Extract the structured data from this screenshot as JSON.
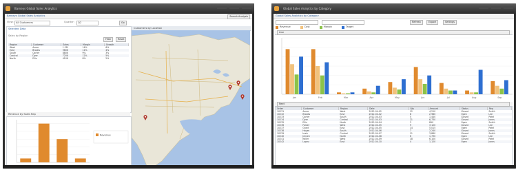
{
  "left_window": {
    "title": "Barneys Global Sales Analytics",
    "header_button": "Search Analysis",
    "toolbar": {
      "field_a_label": "View:",
      "field_a_value": "All Customers",
      "field_b_label": "Quarter:",
      "field_b_value": "Q2",
      "go_label": "Go"
    },
    "filter_title": "Selected Data",
    "list_title": "Sales by Region",
    "mini_btn_a": "Filter",
    "mini_btn_b": "Reset",
    "table": {
      "headers": [
        "Region",
        "Customer",
        "Sales",
        "Margin",
        "Growth"
      ],
      "rows": [
        [
          "West",
          "Acme",
          "1.2M",
          "14%",
          "6%"
        ],
        [
          "East",
          "Brooks",
          "960K",
          "11%",
          "4%"
        ],
        [
          "South",
          "Carter",
          "880K",
          "9%",
          "3%"
        ],
        [
          "Central",
          "Dyer",
          "720K",
          "12%",
          "5%"
        ],
        [
          "North",
          "Ellis",
          "410K",
          "8%",
          "2%"
        ]
      ]
    },
    "map_title": "Customers by Location",
    "map_pins": [
      {
        "name": "pin-west-coast",
        "color": "#c0392b"
      },
      {
        "name": "pin-chicago",
        "color": "#c0392b"
      },
      {
        "name": "pin-northeast",
        "color": "#c0392b"
      },
      {
        "name": "pin-southeast",
        "color": "#c0392b"
      }
    ],
    "bar_panel_title": "Revenue by Sales Rep",
    "bar_legend": [
      "Revenue"
    ]
  },
  "right_window": {
    "title": "Global Sales Analytics by Category",
    "toolbar_buttons": [
      "Refresh",
      "Export",
      "Settings"
    ],
    "legend": [
      "Revenue",
      "Cost",
      "Margin",
      "Target"
    ],
    "chart_title": "Sales Trends",
    "chart_buttons": [
      "Bar",
      "Line"
    ],
    "table_title": "Transactions",
    "table_buttons": [
      "Prev",
      "Next"
    ],
    "table": {
      "headers": [
        "Order",
        "Customer",
        "Region",
        "Date",
        "Qty",
        "Amount",
        "Status",
        "Rep"
      ],
      "rows": [
        [
          "10231",
          "Acme",
          "West",
          "2012-04-02",
          "12",
          "4,210",
          "Closed",
          "Smith"
        ],
        [
          "10232",
          "Brooks",
          "East",
          "2012-04-02",
          "8",
          "2,980",
          "Open",
          "Lee"
        ],
        [
          "10233",
          "Carter",
          "South",
          "2012-04-03",
          "5",
          "1,440",
          "Closed",
          "Patel"
        ],
        [
          "10234",
          "Dyer",
          "Central",
          "2012-04-03",
          "21",
          "6,730",
          "Closed",
          "Jones"
        ],
        [
          "10235",
          "Ellis",
          "North",
          "2012-04-04",
          "3",
          "890",
          "Open",
          "Smith"
        ],
        [
          "10236",
          "Foster",
          "West",
          "2012-04-05",
          "9",
          "3,120",
          "Closed",
          "Lee"
        ],
        [
          "10237",
          "Grant",
          "East",
          "2012-04-05",
          "14",
          "5,015",
          "Open",
          "Patel"
        ],
        [
          "10238",
          "Hayes",
          "South",
          "2012-04-06",
          "7",
          "2,240",
          "Closed",
          "Jones"
        ],
        [
          "10239",
          "Irwin",
          "Central",
          "2012-04-07",
          "11",
          "3,860",
          "Closed",
          "Smith"
        ],
        [
          "10240",
          "Jensen",
          "North",
          "2012-04-08",
          "6",
          "1,730",
          "Open",
          "Lee"
        ],
        [
          "10241",
          "Keller",
          "West",
          "2012-04-09",
          "18",
          "6,100",
          "Closed",
          "Patel"
        ],
        [
          "10242",
          "Lopez",
          "East",
          "2012-04-10",
          "4",
          "1,120",
          "Open",
          "Jones"
        ]
      ]
    }
  },
  "chart_data": [
    {
      "type": "bar",
      "categories": [
        "Rep 1",
        "Rep 2",
        "Rep 3",
        "Rep 4"
      ],
      "values": [
        0.1,
        1.0,
        0.6,
        0.1
      ],
      "ylim": [
        0,
        1.1
      ]
    },
    {
      "type": "bar",
      "categories": [
        "Jan",
        "Feb",
        "Mar",
        "Apr",
        "May",
        "Jun",
        "Jul",
        "Aug",
        "Sep"
      ],
      "series": [
        {
          "name": "Revenue",
          "color": "#e08a2e",
          "values": [
            4.8,
            4.8,
            0.2,
            0.6,
            1.3,
            2.9,
            1.2,
            0.4,
            1.4
          ]
        },
        {
          "name": "Cost",
          "color": "#f1c27d",
          "values": [
            3.2,
            3.0,
            0.1,
            0.3,
            0.7,
            1.6,
            0.6,
            0.2,
            0.9
          ]
        },
        {
          "name": "Margin",
          "color": "#8cc34a",
          "values": [
            2.1,
            2.0,
            0.1,
            0.2,
            0.5,
            1.1,
            0.4,
            0.2,
            0.6
          ]
        },
        {
          "name": "Target",
          "color": "#2e6fd1",
          "values": [
            4.0,
            3.4,
            0.2,
            0.9,
            1.6,
            2.0,
            0.4,
            2.6,
            1.5
          ]
        }
      ],
      "ylim": [
        0,
        6
      ]
    }
  ],
  "colors": {
    "window_chrome": "#2e2e2e",
    "panel_header": "#e7ebf0",
    "map_water": "#a8c3e6",
    "map_land": "#e9e6d8",
    "bar_orange": "#e08a2e"
  }
}
